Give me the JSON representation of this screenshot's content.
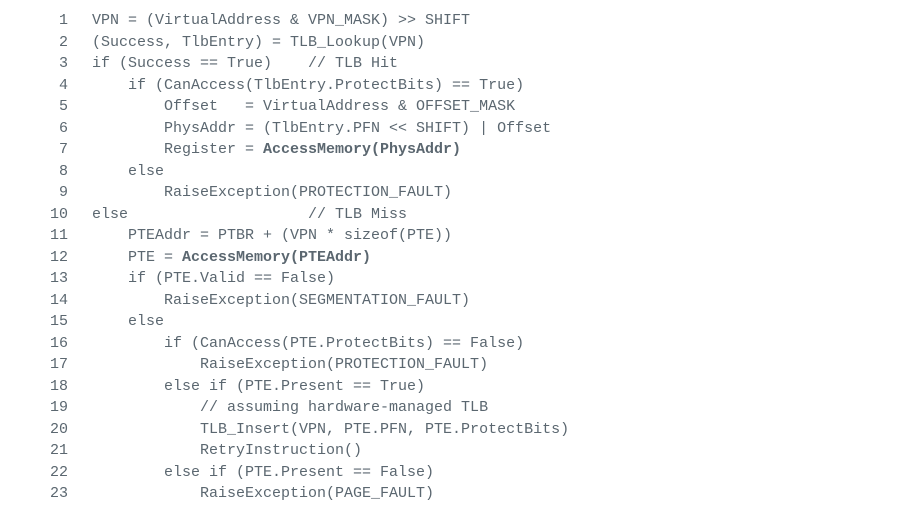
{
  "code": {
    "lines": [
      {
        "n": "1",
        "segments": [
          {
            "t": "VPN = (VirtualAddress & VPN_MASK) >> SHIFT",
            "b": false
          }
        ]
      },
      {
        "n": "2",
        "segments": [
          {
            "t": "(Success, TlbEntry) = TLB_Lookup(VPN)",
            "b": false
          }
        ]
      },
      {
        "n": "3",
        "segments": [
          {
            "t": "if (Success == True)    // TLB Hit",
            "b": false
          }
        ]
      },
      {
        "n": "4",
        "segments": [
          {
            "t": "    if (CanAccess(TlbEntry.ProtectBits) == True)",
            "b": false
          }
        ]
      },
      {
        "n": "5",
        "segments": [
          {
            "t": "        Offset   = VirtualAddress & OFFSET_MASK",
            "b": false
          }
        ]
      },
      {
        "n": "6",
        "segments": [
          {
            "t": "        PhysAddr = (TlbEntry.PFN << SHIFT) | Offset",
            "b": false
          }
        ]
      },
      {
        "n": "7",
        "segments": [
          {
            "t": "        Register = ",
            "b": false
          },
          {
            "t": "AccessMemory(PhysAddr)",
            "b": true
          }
        ]
      },
      {
        "n": "8",
        "segments": [
          {
            "t": "    else",
            "b": false
          }
        ]
      },
      {
        "n": "9",
        "segments": [
          {
            "t": "        RaiseException(PROTECTION_FAULT)",
            "b": false
          }
        ]
      },
      {
        "n": "10",
        "segments": [
          {
            "t": "else                    // TLB Miss",
            "b": false
          }
        ]
      },
      {
        "n": "11",
        "segments": [
          {
            "t": "    PTEAddr = PTBR + (VPN * sizeof(PTE))",
            "b": false
          }
        ]
      },
      {
        "n": "12",
        "segments": [
          {
            "t": "    PTE = ",
            "b": false
          },
          {
            "t": "AccessMemory(PTEAddr)",
            "b": true
          }
        ]
      },
      {
        "n": "13",
        "segments": [
          {
            "t": "    if (PTE.Valid == False)",
            "b": false
          }
        ]
      },
      {
        "n": "14",
        "segments": [
          {
            "t": "        RaiseException(SEGMENTATION_FAULT)",
            "b": false
          }
        ]
      },
      {
        "n": "15",
        "segments": [
          {
            "t": "    else",
            "b": false
          }
        ]
      },
      {
        "n": "16",
        "segments": [
          {
            "t": "        if (CanAccess(PTE.ProtectBits) == False)",
            "b": false
          }
        ]
      },
      {
        "n": "17",
        "segments": [
          {
            "t": "            RaiseException(PROTECTION_FAULT)",
            "b": false
          }
        ]
      },
      {
        "n": "18",
        "segments": [
          {
            "t": "        else if (PTE.Present == True)",
            "b": false
          }
        ]
      },
      {
        "n": "19",
        "segments": [
          {
            "t": "            // assuming hardware-managed TLB",
            "b": false
          }
        ]
      },
      {
        "n": "20",
        "segments": [
          {
            "t": "            TLB_Insert(VPN, PTE.PFN, PTE.ProtectBits)",
            "b": false
          }
        ]
      },
      {
        "n": "21",
        "segments": [
          {
            "t": "            RetryInstruction()",
            "b": false
          }
        ]
      },
      {
        "n": "22",
        "segments": [
          {
            "t": "        else if (PTE.Present == False)",
            "b": false
          }
        ]
      },
      {
        "n": "23",
        "segments": [
          {
            "t": "            RaiseException(PAGE_FAULT)",
            "b": false
          }
        ]
      }
    ]
  }
}
